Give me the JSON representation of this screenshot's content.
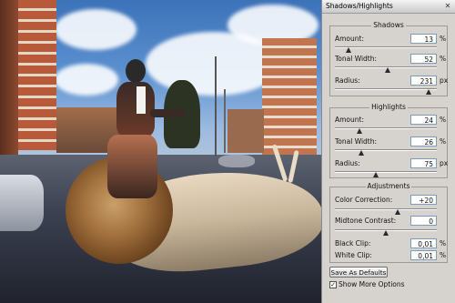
{
  "dialog": {
    "title": "Shadows/Highlights",
    "close_glyph": "✕",
    "shadows": {
      "label": "Shadows",
      "amount": {
        "label": "Amount:",
        "value": "13",
        "unit": "%",
        "level": 0.13
      },
      "tonal_width": {
        "label": "Tonal Width:",
        "value": "52",
        "unit": "%",
        "level": 0.52
      },
      "radius": {
        "label": "Radius:",
        "value": "231",
        "unit": "px",
        "level": 0.92
      }
    },
    "highlights": {
      "label": "Highlights",
      "amount": {
        "label": "Amount:",
        "value": "24",
        "unit": "%",
        "level": 0.24
      },
      "tonal_width": {
        "label": "Tonal Width:",
        "value": "26",
        "unit": "%",
        "level": 0.26
      },
      "radius": {
        "label": "Radius:",
        "value": "75",
        "unit": "px",
        "level": 0.4
      }
    },
    "adjustments": {
      "label": "Adjustments",
      "color_correction": {
        "label": "Color Correction:",
        "value": "+20",
        "level": 0.62
      },
      "midtone_contrast": {
        "label": "Midtone Contrast:",
        "value": "0",
        "level": 0.5
      },
      "black_clip": {
        "label": "Black Clip:",
        "value": "0,01",
        "unit": "%"
      },
      "white_clip": {
        "label": "White Clip:",
        "value": "0,01",
        "unit": "%"
      }
    },
    "save_defaults_label": "Save As Defaults",
    "show_more_options": {
      "label": "Show More Options",
      "checked": true,
      "check_glyph": "✓"
    }
  },
  "colors": {
    "panel_bg": "#d6d3ce",
    "field_border": "#7f9db9",
    "sky": "#5a8fcf",
    "road": "#2b2f3c"
  },
  "icons": [
    "close-icon",
    "checkbox-icon",
    "slider-thumb-icon"
  ]
}
